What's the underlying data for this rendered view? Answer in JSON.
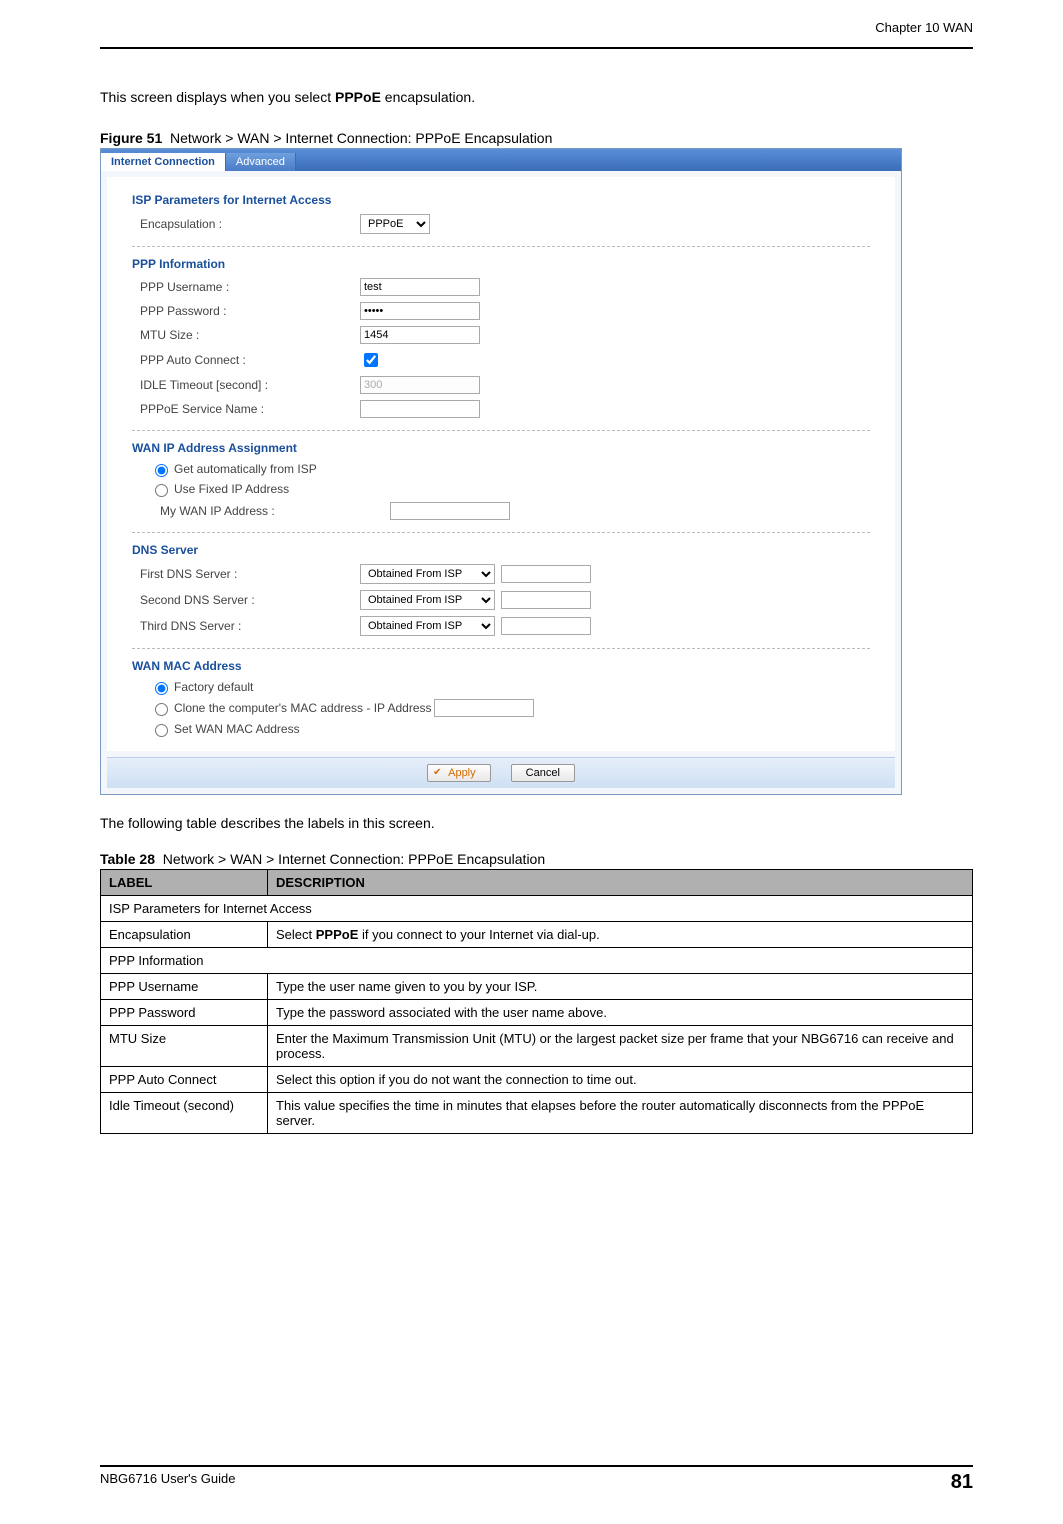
{
  "header": {
    "chapter": "Chapter 10 WAN"
  },
  "intro": {
    "prefix": "This screen displays when you select ",
    "bold": "PPPoE",
    "suffix": " encapsulation."
  },
  "figure": {
    "label": "Figure 51",
    "caption": "Network > WAN > Internet Connection: PPPoE Encapsulation"
  },
  "screenshot": {
    "tabs": {
      "active": "Internet Connection",
      "other": "Advanced"
    },
    "sec1": {
      "title": "ISP Parameters for Internet Access",
      "encap_label": "Encapsulation :",
      "encap_value": "PPPoE"
    },
    "sec2": {
      "title": "PPP Information",
      "user_label": "PPP Username :",
      "user_value": "test",
      "pass_label": "PPP Password :",
      "pass_value": "•••••",
      "mtu_label": "MTU Size :",
      "mtu_value": "1454",
      "auto_label": "PPP Auto Connect :",
      "idle_label": "IDLE Timeout [second] :",
      "idle_value": "300",
      "svc_label": "PPPoE Service Name :",
      "svc_value": ""
    },
    "sec3": {
      "title": "WAN IP Address Assignment",
      "opt1": "Get automatically from ISP",
      "opt2": "Use Fixed IP Address",
      "myip_label": "My WAN IP Address :",
      "myip_value": ""
    },
    "sec4": {
      "title": "DNS Server",
      "d1_label": "First DNS Server :",
      "d1_sel": "Obtained From ISP",
      "d2_label": "Second DNS Server :",
      "d2_sel": "Obtained From ISP",
      "d3_label": "Third DNS Server :",
      "d3_sel": "Obtained From ISP"
    },
    "sec5": {
      "title": "WAN MAC Address",
      "opt1": "Factory default",
      "opt2": "Clone the computer's MAC address - IP Address",
      "opt3": "Set WAN MAC Address"
    },
    "buttons": {
      "apply": "Apply",
      "cancel": "Cancel"
    }
  },
  "after": "The following table describes the labels in this screen.",
  "table": {
    "label": "Table 28",
    "caption": "Network > WAN > Internet Connection: PPPoE Encapsulation",
    "h1": "LABEL",
    "h2": "DESCRIPTION",
    "rows": [
      {
        "span": true,
        "c1": "ISP Parameters for Internet Access"
      },
      {
        "c1": "Encapsulation",
        "c2_pre": "Select ",
        "c2_bold": "PPPoE",
        "c2_post": " if you connect to your Internet via dial-up."
      },
      {
        "span": true,
        "c1": "PPP Information"
      },
      {
        "c1": "PPP Username",
        "c2": "Type the user name given to you by your ISP."
      },
      {
        "c1": "PPP Password",
        "c2": "Type the password associated with the user name above."
      },
      {
        "c1": "MTU Size",
        "c2": "Enter the Maximum Transmission Unit (MTU) or the largest packet size per frame that your NBG6716 can receive and process."
      },
      {
        "c1": "PPP Auto Connect",
        "c2": "Select this option if you do not want the connection to time out."
      },
      {
        "c1": "Idle Timeout (second)",
        "c2": "This value specifies the time in minutes that elapses before the router automatically disconnects from the PPPoE server."
      }
    ]
  },
  "footer": {
    "guide": "NBG6716 User's Guide",
    "page": "81"
  }
}
